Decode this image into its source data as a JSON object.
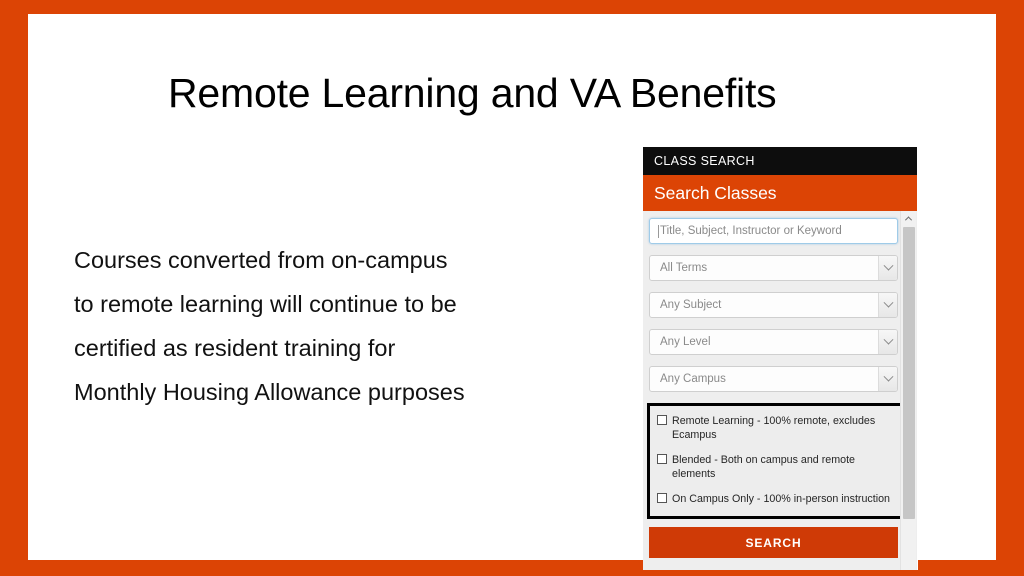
{
  "slide": {
    "title": "Remote Learning and VA Benefits",
    "body_lines": [
      "Courses converted from on-campus",
      "to remote learning will continue to be",
      "certified as resident training for",
      "Monthly Housing Allowance purposes"
    ],
    "border_color": "#DC4405",
    "background_color": "#FFFFFF",
    "title_color": "#000000"
  },
  "class_search": {
    "topbar_label": "CLASS SEARCH",
    "header_title": "Search Classes",
    "topbar_color": "#0D0D0D",
    "header_color": "#DC4405",
    "keyword_input": {
      "value": "",
      "placeholder": "Title, Subject, Instructor or Keyword",
      "focused": true
    },
    "selects": [
      {
        "name": "term",
        "value": "All Terms"
      },
      {
        "name": "subject",
        "value": "Any Subject"
      },
      {
        "name": "level",
        "value": "Any Level"
      },
      {
        "name": "campus",
        "value": "Any Campus"
      }
    ],
    "modality_checkboxes": [
      {
        "label": "Remote Learning - 100% remote, excludes Ecampus",
        "checked": false
      },
      {
        "label": "Blended - Both on campus and remote elements",
        "checked": false
      },
      {
        "label": "On Campus Only - 100% in-person instruction",
        "checked": false
      }
    ],
    "highlight_box_color": "#000000",
    "search_button_label": "SEARCH",
    "search_button_color": "#CF3A06"
  }
}
